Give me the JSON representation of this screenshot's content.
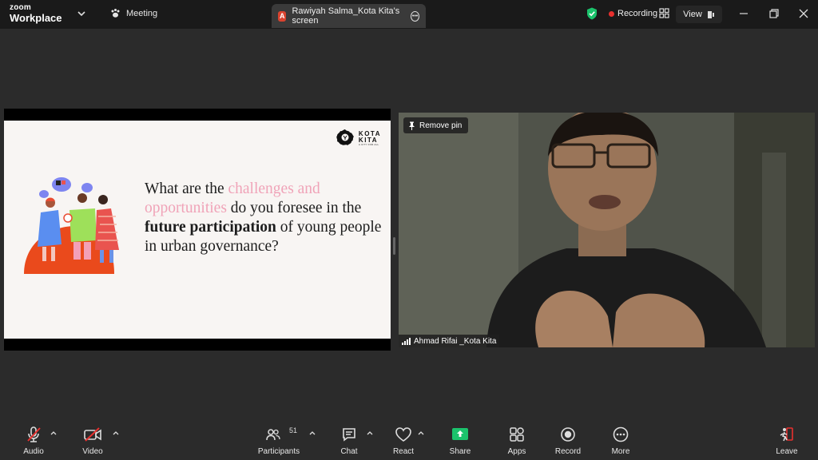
{
  "titlebar": {
    "logo_small": "zoom",
    "logo_big": "Workplace",
    "meeting_label": "Meeting",
    "screen_tab_avatar": "A",
    "screen_tab_label": "Rawiyah Salma_Kota Kita's screen",
    "recording_label": "Recording",
    "view_label": "View"
  },
  "slide": {
    "logo_title_line1": "KOTA",
    "logo_title_line2": "KITA",
    "logo_tagline": "A CITY FOR ALL",
    "q_part1": "What are the ",
    "q_part2": "challenges and opportunities",
    "q_part3": " do you foresee in the ",
    "q_part4": "future participation",
    "q_part5": " of young people in urban governance?"
  },
  "video": {
    "pin_label": "Remove pin",
    "participant_name": "Ahmad Rifai _Kota Kita"
  },
  "toolbar": {
    "audio": "Audio",
    "video": "Video",
    "participants": "Participants",
    "participants_count": "51",
    "chat": "Chat",
    "react": "React",
    "share": "Share",
    "apps": "Apps",
    "record": "Record",
    "more": "More",
    "leave": "Leave"
  },
  "colors": {
    "share_accent": "#1bc36c",
    "recording_dot": "#e8302e",
    "shield": "#1bc36c",
    "slide_pink": "#f0a3b8",
    "leave_red": "#e8302e"
  }
}
